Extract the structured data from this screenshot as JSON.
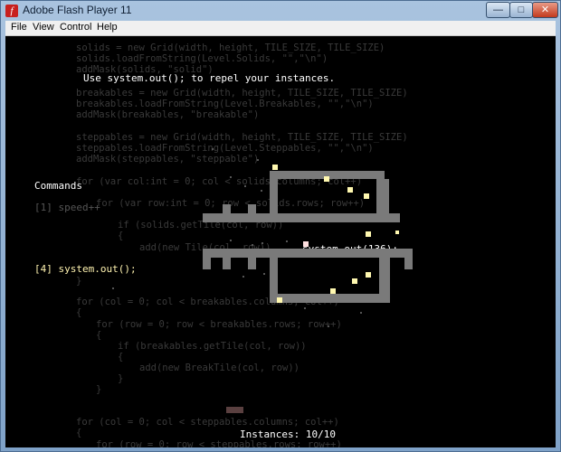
{
  "window": {
    "title": "Adobe Flash Player 11",
    "icon": "flash-icon",
    "controls": {
      "minimize": "—",
      "maximize": "□",
      "close": "✕"
    }
  },
  "menu": {
    "file": "File",
    "view": "View",
    "control": "Control",
    "help": "Help"
  },
  "game": {
    "hint": "Use system.out(); to repel your instances.",
    "commands_title": "Commands",
    "command_1": "[1] speed++",
    "command_4": "[4] system.out();",
    "floating_label": "system.out(136);",
    "instances": "Instances: 10/10"
  },
  "code_lines": [
    "solids = new Grid(width, height, TILE_SIZE, TILE_SIZE)",
    "solids.loadFromString(Level.Solids, \"\",\"\\n\")",
    "addMask(solids, \"solid\")",
    "breakables = new Grid(width, height, TILE_SIZE, TILE_SIZE)",
    "breakables.loadFromString(Level.Breakables, \"\",\"\\n\")",
    "addMask(breakables, \"breakable\")",
    "steppables = new Grid(width, height, TILE_SIZE, TILE_SIZE)",
    "steppables.loadFromString(Level.Steppables, \"\",\"\\n\")",
    "addMask(steppables, \"steppable\")",
    "for (var col:int = 0; col < solids.columns; col++)",
    "for (var row:int = 0; row < solids.rows; row++)",
    "if (solids.getTile(col, row))",
    "{",
    "add(new Tile(col, row))",
    "}",
    "for (col = 0; col < breakables.columns; col++)",
    "{",
    "for (row = 0; row < breakables.rows; row++)",
    "{",
    "if (breakables.getTile(col, row))",
    "{",
    "add(new BreakTile(col, row))",
    "}",
    "}",
    "for (col = 0; col < steppables.columns; col++)",
    "{",
    "for (row = 0; row < steppables.rows; row++)"
  ]
}
